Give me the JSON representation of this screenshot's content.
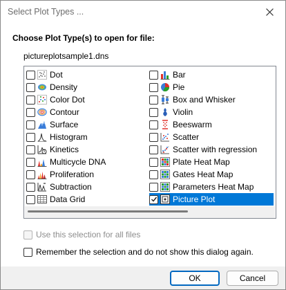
{
  "window": {
    "title": "Select Plot Types ..."
  },
  "heading": "Choose Plot Type(s) to open for file:",
  "filename": "pictureplotsample1.dns",
  "plot_types_left": [
    {
      "label": "Dot",
      "icon": "dot-plot-icon",
      "checked": false
    },
    {
      "label": "Density",
      "icon": "density-plot-icon",
      "checked": false
    },
    {
      "label": "Color Dot",
      "icon": "color-dot-plot-icon",
      "checked": false
    },
    {
      "label": "Contour",
      "icon": "contour-plot-icon",
      "checked": false
    },
    {
      "label": "Surface",
      "icon": "surface-plot-icon",
      "checked": false
    },
    {
      "label": "Histogram",
      "icon": "histogram-icon",
      "checked": false
    },
    {
      "label": "Kinetics",
      "icon": "kinetics-icon",
      "checked": false
    },
    {
      "label": "Multicycle DNA",
      "icon": "multicycle-dna-icon",
      "checked": false
    },
    {
      "label": "Proliferation",
      "icon": "proliferation-icon",
      "checked": false
    },
    {
      "label": "Subtraction",
      "icon": "subtraction-icon",
      "checked": false
    },
    {
      "label": "Data Grid",
      "icon": "data-grid-icon",
      "checked": false
    }
  ],
  "plot_types_right": [
    {
      "label": "Bar",
      "icon": "bar-chart-icon",
      "checked": false
    },
    {
      "label": "Pie",
      "icon": "pie-chart-icon",
      "checked": false
    },
    {
      "label": "Box and Whisker",
      "icon": "box-whisker-icon",
      "checked": false
    },
    {
      "label": "Violin",
      "icon": "violin-plot-icon",
      "checked": false
    },
    {
      "label": "Beeswarm",
      "icon": "beeswarm-icon",
      "checked": false
    },
    {
      "label": "Scatter",
      "icon": "scatter-plot-icon",
      "checked": false
    },
    {
      "label": "Scatter with regression",
      "icon": "scatter-regression-icon",
      "checked": false
    },
    {
      "label": "Plate Heat Map",
      "icon": "plate-heat-map-icon",
      "checked": false
    },
    {
      "label": "Gates Heat Map",
      "icon": "gates-heat-map-icon",
      "checked": false
    },
    {
      "label": "Parameters Heat Map",
      "icon": "parameters-heat-map-icon",
      "checked": false
    },
    {
      "label": "Picture Plot",
      "icon": "picture-plot-icon",
      "checked": true,
      "selected": true
    }
  ],
  "options": {
    "use_for_all": {
      "label": "Use this selection for all files",
      "checked": false,
      "enabled": false
    },
    "remember": {
      "label": "Remember the selection and do not show this dialog again.",
      "checked": false,
      "enabled": true
    }
  },
  "buttons": {
    "ok": "OK",
    "cancel": "Cancel"
  },
  "colors": {
    "selection": "#0078d7",
    "ok_border": "#0067c0"
  }
}
